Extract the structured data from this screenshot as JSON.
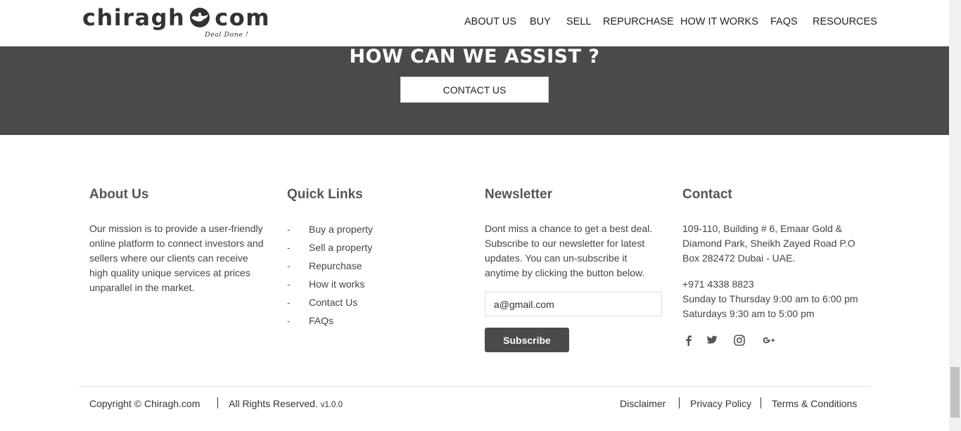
{
  "header": {
    "logo_left": "chiragh",
    "logo_right": "com",
    "tagline": "Deal Done !",
    "nav": [
      "ABOUT US",
      "BUY",
      "SELL",
      "REPURCHASE",
      "HOW IT WORKS",
      "FAQS",
      "RESOURCES"
    ]
  },
  "assist": {
    "title": "HOW CAN WE ASSIST ?",
    "button": "CONTACT US"
  },
  "footer": {
    "about": {
      "title": "About Us",
      "text": "Our mission is to provide a user-friendly online platform to connect investors and sellers where our clients can receive high quality unique services at prices unparallel in the market."
    },
    "quick_links": {
      "title": "Quick Links",
      "dash": "-",
      "items": [
        "Buy a property",
        "Sell a property",
        "Repurchase",
        "How it works",
        "Contact Us",
        "FAQs"
      ]
    },
    "newsletter": {
      "title": "Newsletter",
      "text": "Dont miss a chance to get a best deal. Subscribe to our newsletter for latest updates. You can un-subscribe it anytime by clicking the button below.",
      "email_value": "a@gmail.com",
      "button": "Subscribe"
    },
    "contact": {
      "title": "Contact",
      "address": "109-110, Building # 6, Emaar Gold & Diamond Park, Sheikh Zayed Road P.O Box 282472 Dubai - UAE.",
      "phone": "+971 4338 8823",
      "hours_weekday": "Sunday to Thursday 9:00 am to 6:00 pm",
      "hours_saturday": "Saturdays 9:30 am to 5:00 pm",
      "social_icons": [
        "facebook-icon",
        "twitter-icon",
        "instagram-icon",
        "google-plus-icon"
      ]
    }
  },
  "bottom": {
    "copyright": "Copyright © Chiragh.com",
    "rights": "All Rights Reserved.",
    "version": "v1.0.0",
    "links": [
      "Disclaimer",
      "Privacy Policy",
      "Terms & Conditions"
    ]
  },
  "colors": {
    "band": "#4a4a4a",
    "heading": "#555555",
    "text": "#444444"
  }
}
